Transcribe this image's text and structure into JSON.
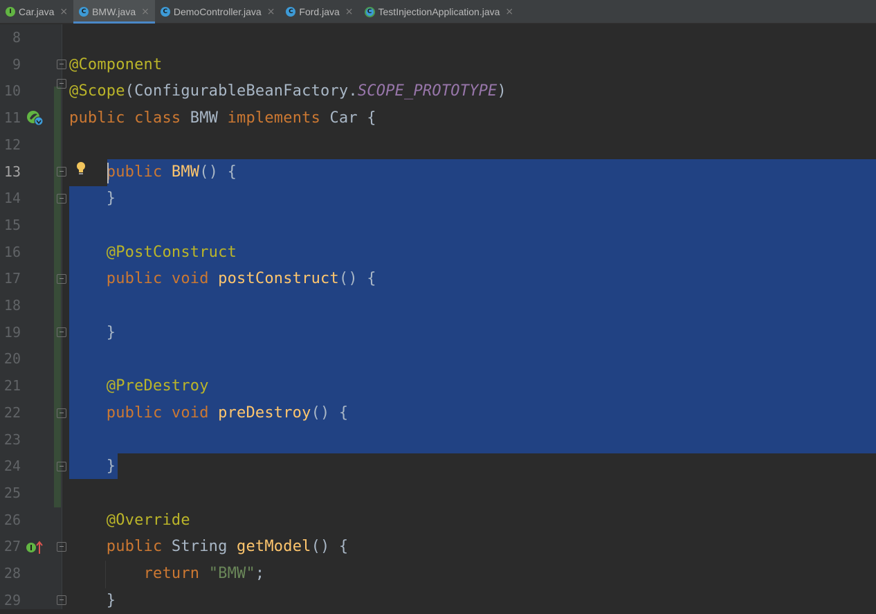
{
  "tabs": [
    {
      "label": "Car.java",
      "icon": "interface-icon",
      "icon_glyph": "I",
      "active": false
    },
    {
      "label": "BMW.java",
      "icon": "class-icon",
      "icon_glyph": "C",
      "active": true
    },
    {
      "label": "DemoController.java",
      "icon": "class-icon",
      "icon_glyph": "C",
      "active": false
    },
    {
      "label": "Ford.java",
      "icon": "class-icon",
      "icon_glyph": "C",
      "active": false
    },
    {
      "label": "TestInjectionApplication.java",
      "icon": "spring-app-icon",
      "icon_glyph": "C",
      "active": false
    }
  ],
  "close_glyph": "×",
  "editor": {
    "current_line": 13,
    "lines": [
      {
        "n": "8",
        "tokens": []
      },
      {
        "n": "9",
        "tokens": [
          {
            "t": "@Component",
            "c": "ann"
          }
        ]
      },
      {
        "n": "10",
        "tokens": [
          {
            "t": "@Scope",
            "c": "ann"
          },
          {
            "t": "(ConfigurableBeanFactory.",
            "c": ""
          },
          {
            "t": "SCOPE_PROTOTYPE",
            "c": "const"
          },
          {
            "t": ")",
            "c": ""
          }
        ]
      },
      {
        "n": "11",
        "tokens": [
          {
            "t": "public class ",
            "c": "kw"
          },
          {
            "t": "BMW ",
            "c": ""
          },
          {
            "t": "implements ",
            "c": "kw"
          },
          {
            "t": "Car {",
            "c": ""
          }
        ]
      },
      {
        "n": "12",
        "tokens": []
      },
      {
        "n": "13",
        "tokens": [
          {
            "t": "    ",
            "c": ""
          },
          {
            "t": "public ",
            "c": "kw"
          },
          {
            "t": "BMW",
            "c": "fn"
          },
          {
            "t": "() {",
            "c": ""
          }
        ]
      },
      {
        "n": "14",
        "tokens": [
          {
            "t": "    }",
            "c": ""
          }
        ]
      },
      {
        "n": "15",
        "tokens": []
      },
      {
        "n": "16",
        "tokens": [
          {
            "t": "    ",
            "c": ""
          },
          {
            "t": "@PostConstruct",
            "c": "ann"
          }
        ]
      },
      {
        "n": "17",
        "tokens": [
          {
            "t": "    ",
            "c": ""
          },
          {
            "t": "public void ",
            "c": "kw"
          },
          {
            "t": "postConstruct",
            "c": "fn"
          },
          {
            "t": "() {",
            "c": ""
          }
        ]
      },
      {
        "n": "18",
        "tokens": []
      },
      {
        "n": "19",
        "tokens": [
          {
            "t": "    }",
            "c": ""
          }
        ]
      },
      {
        "n": "20",
        "tokens": []
      },
      {
        "n": "21",
        "tokens": [
          {
            "t": "    ",
            "c": ""
          },
          {
            "t": "@PreDestroy",
            "c": "ann"
          }
        ]
      },
      {
        "n": "22",
        "tokens": [
          {
            "t": "    ",
            "c": ""
          },
          {
            "t": "public void ",
            "c": "kw"
          },
          {
            "t": "preDestroy",
            "c": "fn"
          },
          {
            "t": "() {",
            "c": ""
          }
        ]
      },
      {
        "n": "23",
        "tokens": []
      },
      {
        "n": "24",
        "tokens": [
          {
            "t": "    }",
            "c": ""
          }
        ]
      },
      {
        "n": "25",
        "tokens": []
      },
      {
        "n": "26",
        "tokens": [
          {
            "t": "    ",
            "c": ""
          },
          {
            "t": "@Override",
            "c": "ann"
          }
        ]
      },
      {
        "n": "27",
        "tokens": [
          {
            "t": "    ",
            "c": ""
          },
          {
            "t": "public ",
            "c": "kw"
          },
          {
            "t": "String ",
            "c": ""
          },
          {
            "t": "getModel",
            "c": "fn"
          },
          {
            "t": "() {",
            "c": ""
          }
        ]
      },
      {
        "n": "28",
        "tokens": [
          {
            "t": "        ",
            "c": ""
          },
          {
            "t": "return ",
            "c": "kw"
          },
          {
            "t": "\"BMW\"",
            "c": "str"
          },
          {
            "t": ";",
            "c": ""
          }
        ]
      },
      {
        "n": "29",
        "tokens": [
          {
            "t": "    }",
            "c": ""
          }
        ]
      }
    ]
  },
  "colors": {
    "background": "#2b2b2b",
    "selection": "#214283",
    "keyword": "#cc7832",
    "annotation": "#bbb529",
    "method": "#ffc66d",
    "string": "#6a8759",
    "constant": "#9876aa"
  }
}
